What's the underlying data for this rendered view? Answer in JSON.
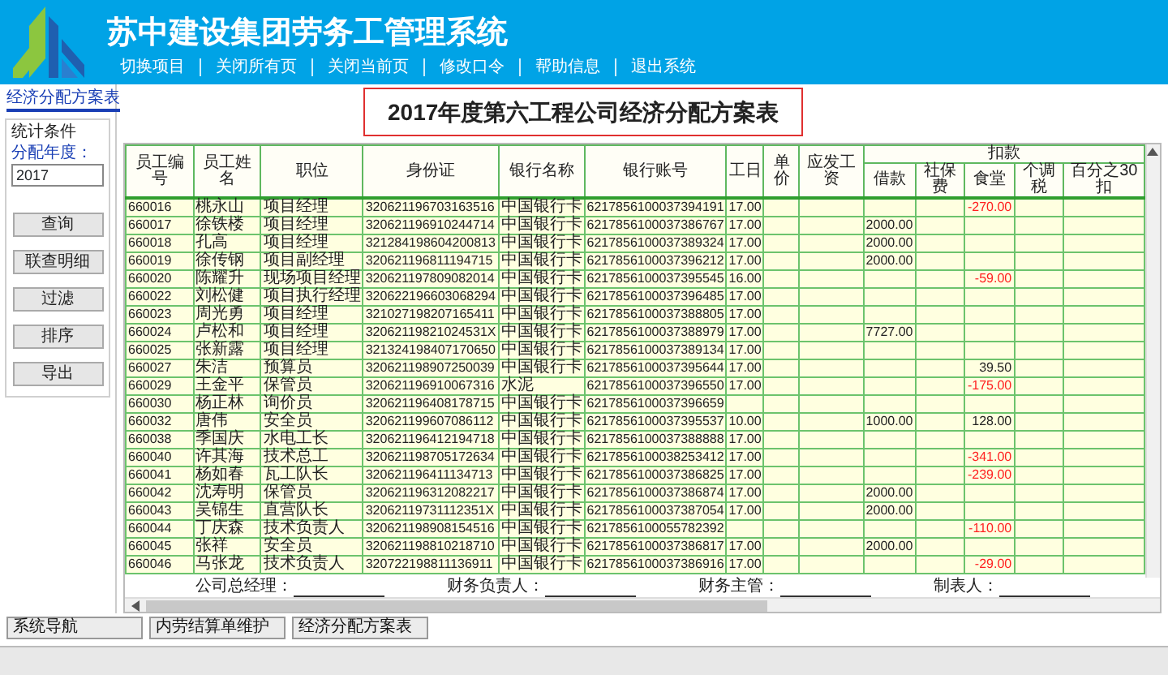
{
  "app": {
    "title": "苏中建设集团劳务工管理系统",
    "nav": [
      "切换项目",
      "关闭所有页",
      "关闭当前页",
      "修改口令",
      "帮助信息",
      "退出系统"
    ]
  },
  "page_tab": "经济分配方案表",
  "filter": {
    "title": "统计条件",
    "year_label": "分配年度：",
    "year_value": "2017",
    "buttons": [
      "查询",
      "联查明细",
      "过滤",
      "排序",
      "导出"
    ]
  },
  "report": {
    "title": "2017年度第六工程公司经济分配方案表",
    "columns": [
      "员工编号",
      "员工姓名",
      "职位",
      "身份证",
      "银行名称",
      "银行账号",
      "工日",
      "单价",
      "应发工资"
    ],
    "deduction_group": {
      "label": "扣款",
      "columns": [
        "借款",
        "社保费",
        "食堂",
        "个调税",
        "百分之30扣"
      ]
    },
    "rows": [
      {
        "employee_no": "660016",
        "name": "桃永山",
        "position": "项目经理",
        "id_card": "320621196703163516",
        "bank": "中国银行卡",
        "account": "6217856100037394191",
        "work_days": "17.00",
        "canteen": {
          "amount": "-270.00",
          "negative": true
        }
      },
      {
        "employee_no": "660017",
        "name": "徐铁楼",
        "position": "项目经理",
        "id_card": "320621196910244714",
        "bank": "中国银行卡",
        "account": "6217856100037386767",
        "work_days": "17.00",
        "loan": "2000.00"
      },
      {
        "employee_no": "660018",
        "name": "孔高",
        "position": "项目经理",
        "id_card": "321284198604200813",
        "bank": "中国银行卡",
        "account": "6217856100037389324",
        "work_days": "17.00",
        "loan": "2000.00"
      },
      {
        "employee_no": "660019",
        "name": "徐传钢",
        "position": "项目副经理",
        "id_card": "320621196811194715",
        "bank": "中国银行卡",
        "account": "6217856100037396212",
        "work_days": "17.00",
        "loan": "2000.00"
      },
      {
        "employee_no": "660020",
        "name": "陈耀升",
        "position": "现场项目经理",
        "id_card": "320621197809082014",
        "bank": "中国银行卡",
        "account": "6217856100037395545",
        "work_days": "16.00",
        "canteen": {
          "amount": "-59.00",
          "negative": true
        }
      },
      {
        "employee_no": "660022",
        "name": "刘松健",
        "position": "项目执行经理",
        "id_card": "320622196603068294",
        "bank": "中国银行卡",
        "account": "6217856100037396485",
        "work_days": "17.00"
      },
      {
        "employee_no": "660023",
        "name": "周光勇",
        "position": "项目经理",
        "id_card": "321027198207165411",
        "bank": "中国银行卡",
        "account": "6217856100037388805",
        "work_days": "17.00"
      },
      {
        "employee_no": "660024",
        "name": "卢松和",
        "position": "项目经理",
        "id_card": "32062119821024531X",
        "bank": "中国银行卡",
        "account": "6217856100037388979",
        "work_days": "17.00",
        "loan": "7727.00"
      },
      {
        "employee_no": "660025",
        "name": "张新露",
        "position": "项目经理",
        "id_card": "321324198407170650",
        "bank": "中国银行卡",
        "account": "6217856100037389134",
        "work_days": "17.00"
      },
      {
        "employee_no": "660027",
        "name": "朱洁",
        "position": "预算员",
        "id_card": "320621198907250039",
        "bank": "中国银行卡",
        "account": "6217856100037395644",
        "work_days": "17.00",
        "canteen": {
          "amount": "39.50",
          "negative": false
        }
      },
      {
        "employee_no": "660029",
        "name": "王金平",
        "position": "保管员",
        "id_card": "320621196910067316",
        "bank": "水泥",
        "account": "6217856100037396550",
        "work_days": "17.00",
        "canteen": {
          "amount": "-175.00",
          "negative": true
        }
      },
      {
        "employee_no": "660030",
        "name": "杨正林",
        "position": "询价员",
        "id_card": "320621196408178715",
        "bank": "中国银行卡",
        "account": "6217856100037396659"
      },
      {
        "employee_no": "660032",
        "name": "唐伟",
        "position": "安全员",
        "id_card": "320621199607086112",
        "bank": "中国银行卡",
        "account": "6217856100037395537",
        "work_days": "10.00",
        "loan": "1000.00",
        "canteen": {
          "amount": "128.00",
          "negative": false
        }
      },
      {
        "employee_no": "660038",
        "name": "季国庆",
        "position": "水电工长",
        "id_card": "320621196412194718",
        "bank": "中国银行卡",
        "account": "6217856100037388888",
        "work_days": "17.00"
      },
      {
        "employee_no": "660040",
        "name": "许其海",
        "position": "技术总工",
        "id_card": "320621198705172634",
        "bank": "中国银行卡",
        "account": "6217856100038253412",
        "work_days": "17.00",
        "canteen": {
          "amount": "-341.00",
          "negative": true
        }
      },
      {
        "employee_no": "660041",
        "name": "杨如春",
        "position": "瓦工队长",
        "id_card": "320621196411134713",
        "bank": "中国银行卡",
        "account": "6217856100037386825",
        "work_days": "17.00",
        "canteen": {
          "amount": "-239.00",
          "negative": true
        }
      },
      {
        "employee_no": "660042",
        "name": "沈寿明",
        "position": "保管员",
        "id_card": "320621196312082217",
        "bank": "中国银行卡",
        "account": "6217856100037386874",
        "work_days": "17.00",
        "loan": "2000.00"
      },
      {
        "employee_no": "660043",
        "name": "吴锦生",
        "position": "直营队长",
        "id_card": "32062119731112351X",
        "bank": "中国银行卡",
        "account": "6217856100037387054",
        "work_days": "17.00",
        "loan": "2000.00"
      },
      {
        "employee_no": "660044",
        "name": "丁庆森",
        "position": "技术负责人",
        "id_card": "320621198908154516",
        "bank": "中国银行卡",
        "account": "6217856100055782392",
        "canteen": {
          "amount": "-110.00",
          "negative": true
        }
      },
      {
        "employee_no": "660045",
        "name": "张祥",
        "position": "安全员",
        "id_card": "320621198810218710",
        "bank": "中国银行卡",
        "account": "6217856100037386817",
        "work_days": "17.00",
        "loan": "2000.00"
      },
      {
        "employee_no": "660046",
        "name": "马张龙",
        "position": "技术负责人",
        "id_card": "320722198811136911",
        "bank": "中国银行卡",
        "account": "6217856100037386916",
        "work_days": "17.00",
        "canteen": {
          "amount": "-29.00",
          "negative": true
        }
      }
    ],
    "signatures": [
      "公司总经理：",
      "财务负责人：",
      "财务主管：",
      "制表人："
    ]
  },
  "window_tabs": [
    "系统导航",
    "内劳结算单维护",
    "经济分配方案表"
  ]
}
